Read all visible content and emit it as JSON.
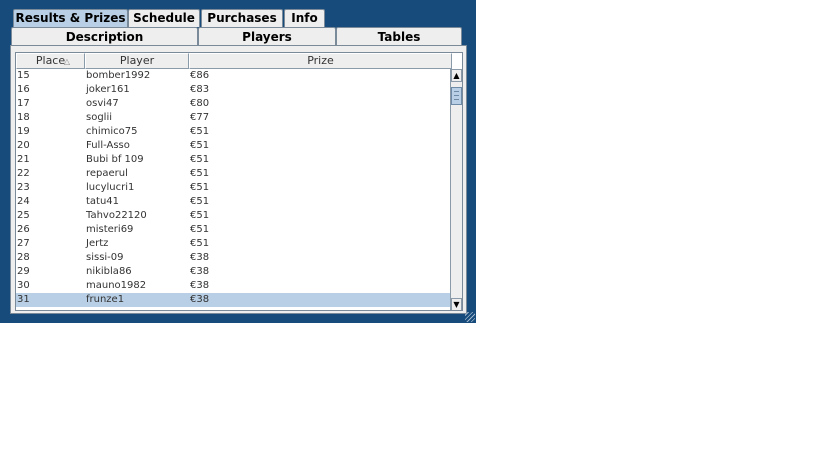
{
  "tabs_top": [
    {
      "label": "Results & Prizes",
      "active": true
    },
    {
      "label": "Schedule",
      "active": false
    },
    {
      "label": "Purchases",
      "active": false
    },
    {
      "label": "Info",
      "active": false
    }
  ],
  "tabs_row2": [
    {
      "label": "Description"
    },
    {
      "label": "Players"
    },
    {
      "label": "Tables"
    }
  ],
  "table": {
    "columns": [
      "Place",
      "Player",
      "Prize"
    ],
    "rows": [
      [
        "15",
        "bomber1992",
        "€86"
      ],
      [
        "16",
        "joker161",
        "€83"
      ],
      [
        "17",
        "osvi47",
        "€80"
      ],
      [
        "18",
        "soglii",
        "€77"
      ],
      [
        "19",
        "chimico75",
        "€51"
      ],
      [
        "20",
        "Full-Asso",
        "€51"
      ],
      [
        "21",
        "Bubi bf 109",
        "€51"
      ],
      [
        "22",
        "repaerul",
        "€51"
      ],
      [
        "23",
        "lucylucri1",
        "€51"
      ],
      [
        "24",
        "tatu41",
        "€51"
      ],
      [
        "25",
        "Tahvo22120",
        "€51"
      ],
      [
        "26",
        "misteri69",
        "€51"
      ],
      [
        "27",
        "Jertz",
        "€51"
      ],
      [
        "28",
        "sissi-09",
        "€38"
      ],
      [
        "29",
        "nikibla86",
        "€38"
      ],
      [
        "30",
        "mauno1982",
        "€38"
      ],
      [
        "31",
        "frunze1",
        "€38"
      ]
    ],
    "selected_row": "31"
  },
  "icons": {
    "scroll_up": "▲",
    "scroll_down": "▼",
    "sort": "△"
  }
}
